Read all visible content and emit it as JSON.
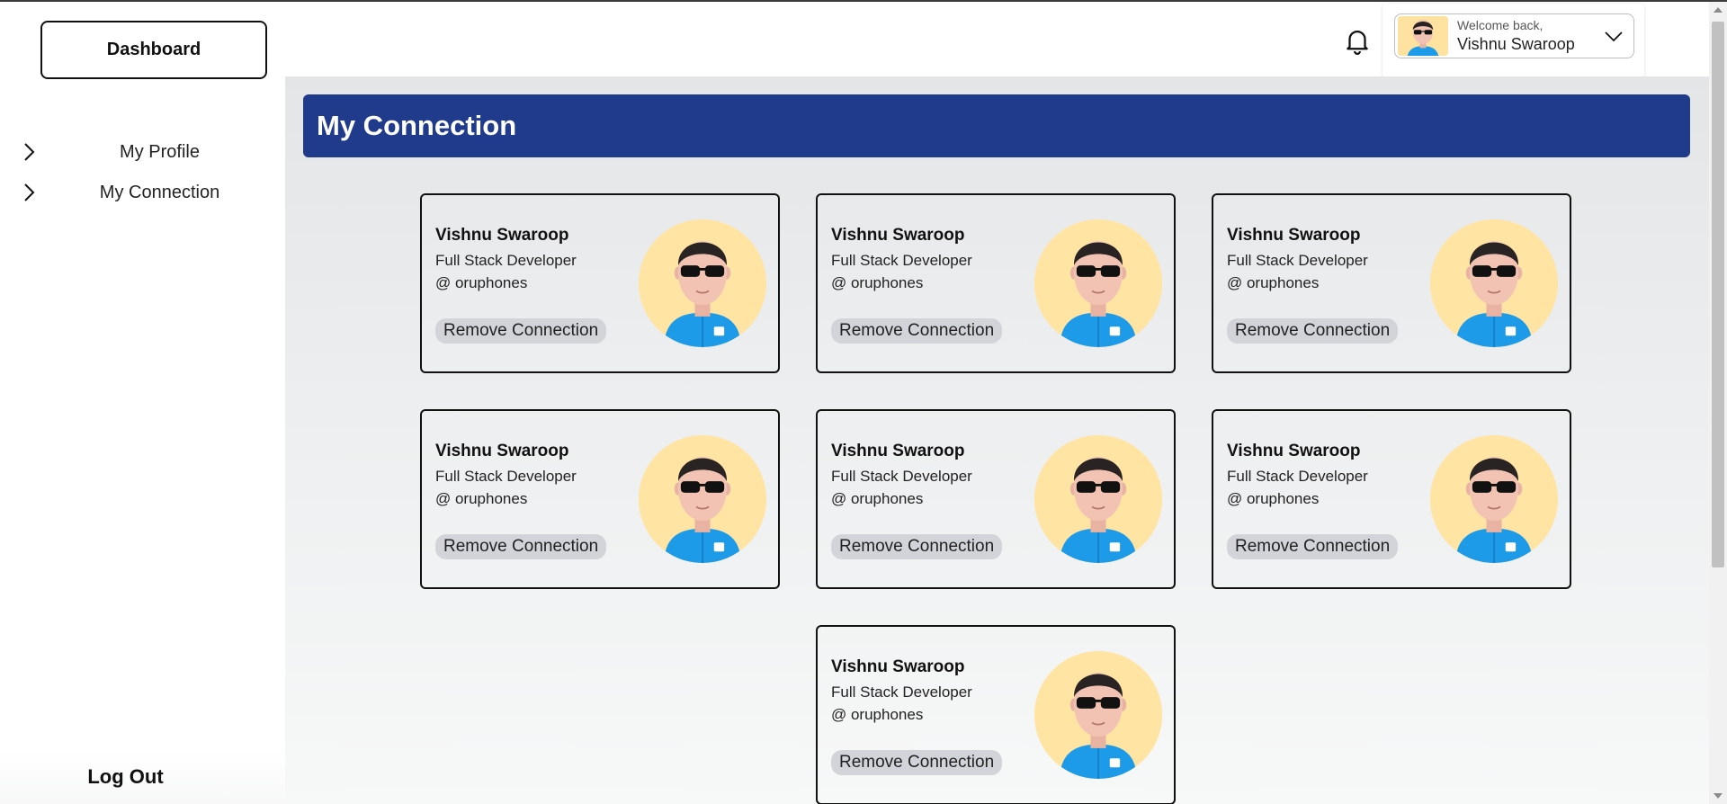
{
  "sidebar": {
    "dashboard_label": "Dashboard",
    "items": [
      {
        "label": "My Profile",
        "icon": "chevron-right-icon"
      },
      {
        "label": "My Connection",
        "icon": "chevron-right-icon"
      }
    ],
    "logout_label": "Log Out"
  },
  "header": {
    "notification_icon": "bell-icon",
    "welcome_text": "Welcome back,",
    "user_name": "Vishnu Swaroop",
    "dropdown_icon": "chevron-down-icon"
  },
  "main": {
    "title": "My Connection",
    "connections": [
      {
        "name": "Vishnu Swaroop",
        "role": "Full Stack Developer",
        "company": "@ oruphones",
        "action": "Remove Connection"
      },
      {
        "name": "Vishnu Swaroop",
        "role": "Full Stack Developer",
        "company": "@ oruphones",
        "action": "Remove Connection"
      },
      {
        "name": "Vishnu Swaroop",
        "role": "Full Stack Developer",
        "company": "@ oruphones",
        "action": "Remove Connection"
      },
      {
        "name": "Vishnu Swaroop",
        "role": "Full Stack Developer",
        "company": "@ oruphones",
        "action": "Remove Connection"
      },
      {
        "name": "Vishnu Swaroop",
        "role": "Full Stack Developer",
        "company": "@ oruphones",
        "action": "Remove Connection"
      },
      {
        "name": "Vishnu Swaroop",
        "role": "Full Stack Developer",
        "company": "@ oruphones",
        "action": "Remove Connection"
      },
      {
        "name": "Vishnu Swaroop",
        "role": "Full Stack Developer",
        "company": "@ oruphones",
        "action": "Remove Connection"
      }
    ]
  },
  "colors": {
    "title_bar": "#203b8c",
    "avatar_bg": "#ffe4a3",
    "button_bg": "#d2d4d9"
  }
}
